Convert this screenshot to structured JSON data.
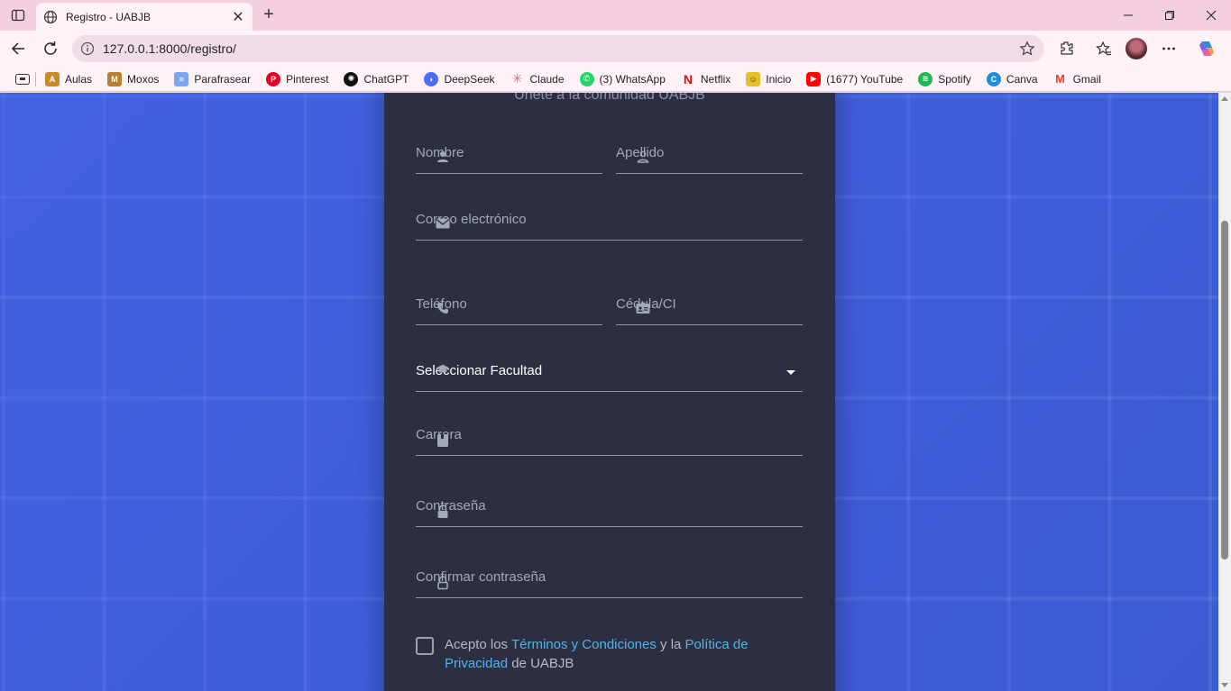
{
  "browser": {
    "tab_title": "Registro - UABJB",
    "url": "127.0.0.1:8000/registro/",
    "bookmarks": [
      "Aulas",
      "Moxos",
      "Parafrasear",
      "Pinterest",
      "ChatGPT",
      "DeepSeek",
      "Claude",
      "(3) WhatsApp",
      "Netflix",
      "Inicio",
      "(1677) YouTube",
      "Spotify",
      "Canva",
      "Gmail"
    ]
  },
  "form": {
    "subtitle": "Únete a la comunidad UABJB",
    "nombre": "Nombre",
    "apellido": "Apellido",
    "correo": "Correo electrónico",
    "telefono": "Teléfono",
    "cedula": "Cédula/CI",
    "facultad": "Seleccionar Facultad",
    "carrera": "Carrera",
    "contrasena": "Contraseña",
    "confirmar": "Confirmar contraseña",
    "terms": {
      "prefix": "Acepto los ",
      "terminos": "Términos y Condiciones",
      "middle": " y la ",
      "politica": "Política de Privacidad",
      "suffix": " de UABJB"
    }
  }
}
